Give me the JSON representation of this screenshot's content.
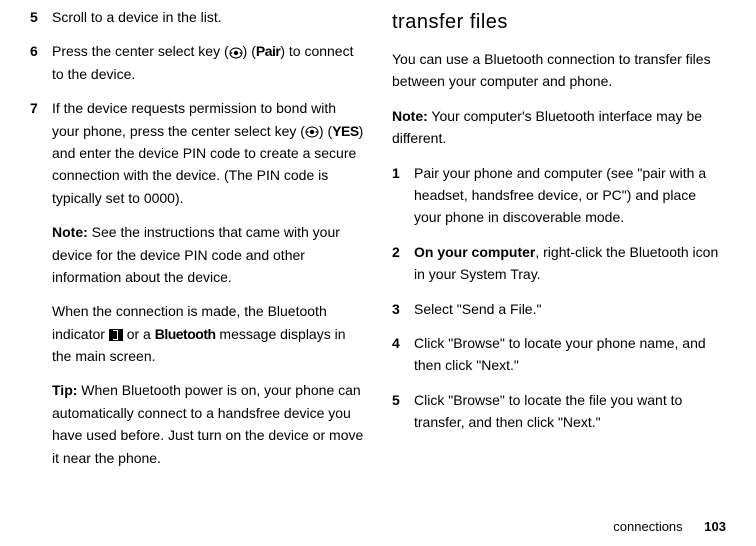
{
  "left": {
    "step5": {
      "num": "5",
      "text": "Scroll to a device in the list."
    },
    "step6": {
      "num": "6",
      "prefix": "Press the center select key (",
      "pair_label": "Pair",
      "suffix": ") to connect to the device."
    },
    "step7": {
      "num": "7",
      "para1_prefix": "If the device requests permission to bond with your phone, press the center select key (",
      "yes_label": "YES",
      "para1_suffix": "and enter the device PIN code to create a secure connection with the device. (The PIN code is typically set to 0000).",
      "note_label": "Note:",
      "note_text": " See the instructions that came with your device for the device PIN code and other information about the device.",
      "para3_prefix": "When the connection is made, the Bluetooth indicator ",
      "bluetooth_label": "Bluetooth",
      "para3_suffix": " message displays in the main screen.",
      "para3_or": " or a ",
      "tip_label": "Tip:",
      "tip_text": " When Bluetooth power is on, your phone can automatically connect to a handsfree device you have used before. Just turn on the device or move it near the phone."
    }
  },
  "right": {
    "heading": "transfer files",
    "intro": "You can use a Bluetooth connection to transfer files between your computer and phone.",
    "note_label": "Note:",
    "note_text": " Your computer's Bluetooth interface may be different.",
    "step1": {
      "num": "1",
      "text": "Pair your phone and computer (see \"pair with a headset, handsfree device, or PC\") and place your phone in discoverable mode."
    },
    "step2": {
      "num": "2",
      "bold": "On your computer",
      "rest": ", right-click the Bluetooth icon in your System Tray."
    },
    "step3": {
      "num": "3",
      "text": "Select \"Send a File.\""
    },
    "step4": {
      "num": "4",
      "text": "Click \"Browse\" to locate your phone name, and then click \"Next.\""
    },
    "step5": {
      "num": "5",
      "text": "Click \"Browse\" to locate the file you want to transfer, and then click \"Next.\""
    }
  },
  "footer": {
    "section": "connections",
    "page": "103"
  }
}
